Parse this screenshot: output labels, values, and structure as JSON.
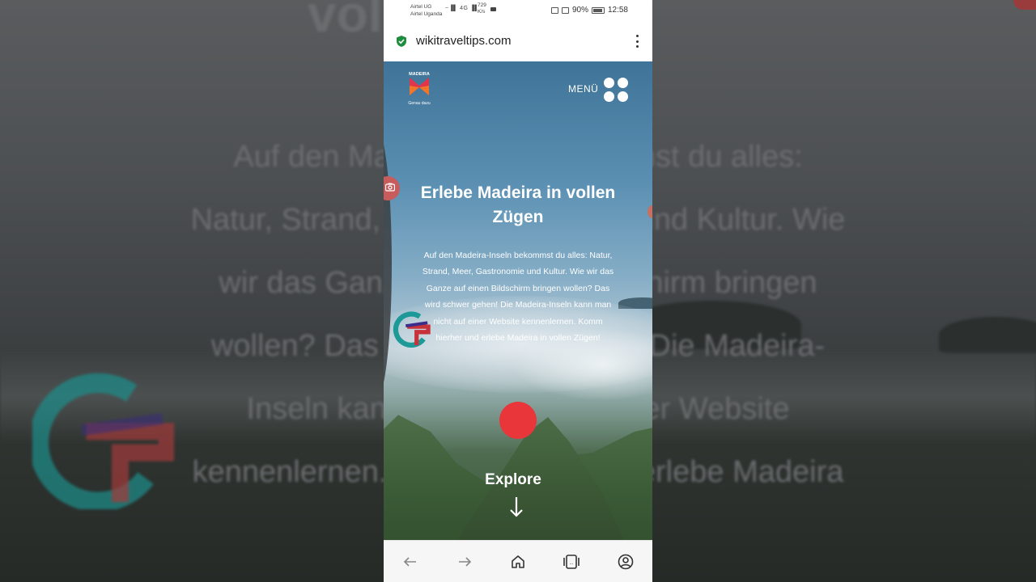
{
  "backdrop": {
    "title_fragment": "voll en",
    "lines": [
      "Auf den Mad                          mst du alles:",
      "Natur, Strand, M                          und Kultur. Wie",
      "wir das Ganz                             hirm bringen",
      "wollen? Das w                          ! Die Madeira-",
      "Inseln kann                          ner Website",
      "kennenlernen. K                          erlebe Madeira"
    ]
  },
  "statusbar": {
    "carrier1": "Airtel UG",
    "carrier2": "Airtel Uganda",
    "signal": "┈▐▌ 4G ▐▌",
    "rate_value": "729",
    "rate_unit": "K/s",
    "battery": "90%",
    "time": "12:58"
  },
  "browser": {
    "url": "wikitraveltips.com"
  },
  "site": {
    "menu_label": "MENÜ",
    "logo_text_top": "MADEIRA",
    "logo_text_bottom": "Genau dazu",
    "hero_title": "Erlebe Madeira in vollen Zügen",
    "hero_text": "Auf den Madeira-Inseln bekommst du alles: Natur, Strand, Meer, Gastronomie und Kultur. Wie wir das Ganze auf einen Bildschirm bringen wollen? Das wird schwer gehen! Die Madeira-Inseln kann man nicht auf einer Website kennenlernen. Komm hierher und erlebe Madeira in vollen Zügen!",
    "explore_label": "Explore"
  },
  "colors": {
    "record_dot": "#e8363a",
    "secure_shield": "#1e8e3e",
    "logo_red": "#e2344a",
    "logo_orange": "#f2762a"
  },
  "icons": [
    "shield-check-icon",
    "more-vert-icon",
    "menu-grid-icon",
    "camera-icon",
    "arrow-down-icon",
    "back-icon",
    "forward-icon",
    "home-icon",
    "tabs-icon",
    "account-icon"
  ]
}
